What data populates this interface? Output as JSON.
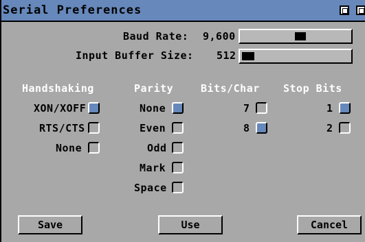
{
  "window": {
    "title": "Serial Preferences"
  },
  "baud": {
    "label": "Baud Rate:",
    "value": "9,600",
    "level": 0.55
  },
  "buffer": {
    "label": "Input Buffer Size:",
    "value": "512",
    "level": 0.0
  },
  "handshaking": {
    "header": "Handshaking",
    "options": [
      "XON/XOFF",
      "RTS/CTS",
      "None"
    ],
    "selected": "XON/XOFF"
  },
  "parity": {
    "header": "Parity",
    "options": [
      "None",
      "Even",
      "Odd",
      "Mark",
      "Space"
    ],
    "selected": "None"
  },
  "bits_char": {
    "header": "Bits/Char",
    "options": [
      "7",
      "8"
    ],
    "selected": "8"
  },
  "stop_bits": {
    "header": "Stop Bits",
    "options": [
      "1",
      "2"
    ],
    "selected": "1"
  },
  "buttons": {
    "save": "Save",
    "use": "Use",
    "cancel": "Cancel"
  },
  "colors": {
    "accent": "#6688bb",
    "background": "#a8a8a8"
  }
}
